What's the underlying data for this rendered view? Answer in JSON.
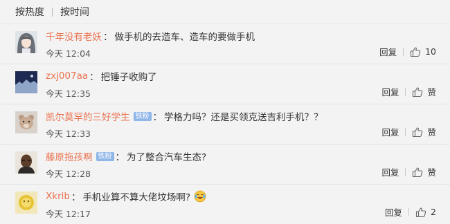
{
  "sort": {
    "hot": "按热度",
    "time": "按时间"
  },
  "comments": [
    {
      "user": "千年没有老妖",
      "badge": "",
      "text": "做手机的去造车、造车的要做手机",
      "emoji": "",
      "time": "今天 12:04",
      "reply": "回复",
      "like": "10",
      "avatar_icon": "anime-girl-avatar"
    },
    {
      "user": "zxj007aa",
      "badge": "",
      "text": "把锤子收购了",
      "emoji": "",
      "time": "今天 12:35",
      "reply": "回复",
      "like": "赞",
      "avatar_icon": "night-scene-avatar"
    },
    {
      "user": "凯尔莫罕的三好学生",
      "badge": "铁粉",
      "text": "学格力吗？还是买领克送吉利手机？？",
      "emoji": "",
      "time": "今天 12:33",
      "reply": "回复",
      "like": "赞",
      "avatar_icon": "teddy-bear-avatar"
    },
    {
      "user": "藤原拖孩啊",
      "badge": "铁粉",
      "text": "为了整合汽车生态?",
      "emoji": "",
      "time": "今天 12:28",
      "reply": "回复",
      "like": "赞",
      "avatar_icon": "man-portrait-avatar"
    },
    {
      "user": "Xkrib",
      "badge": "",
      "text": "手机业算不算大佬坟场啊?",
      "emoji": "laughing-crying-emoji",
      "time": "今天 12:17",
      "reply": "回复",
      "like": "2",
      "avatar_icon": "yellow-bowl-avatar"
    }
  ],
  "colors": {
    "username": "#eb7350",
    "badge": "#8fb6e8",
    "background": "#f3f3f3"
  }
}
